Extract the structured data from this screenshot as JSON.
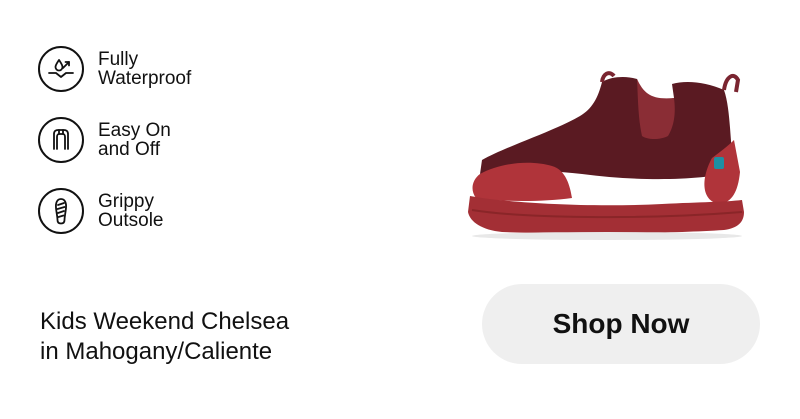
{
  "features": [
    {
      "label": "Fully\nWaterproof",
      "icon": "waterproof-icon"
    },
    {
      "label": "Easy On\nand Off",
      "icon": "easy-on-off-icon"
    },
    {
      "label": "Grippy\nOutsole",
      "icon": "grippy-outsole-icon"
    }
  ],
  "product": {
    "name": "Kids Weekend Chelsea\nin Mahogany/Caliente",
    "image_alt": "Kids Weekend Chelsea boot in Mahogany/Caliente"
  },
  "cta": {
    "label": "Shop Now"
  },
  "colors": {
    "upper": "#5a1a22",
    "sole": "#b0343a",
    "tab": "#1e8fa3",
    "button_bg": "#efefef"
  }
}
